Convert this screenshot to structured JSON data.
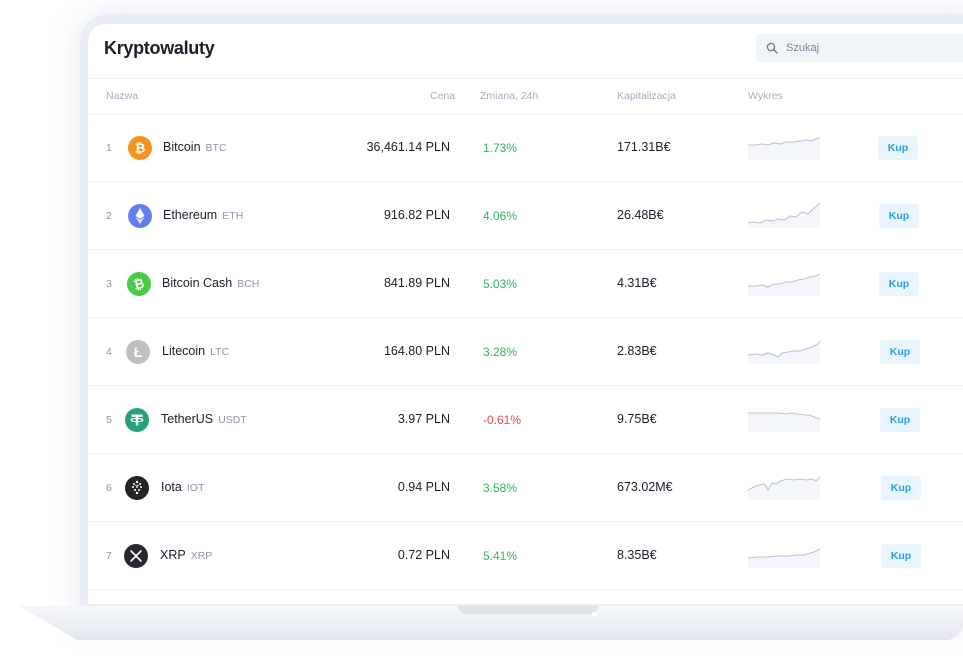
{
  "header": {
    "title": "Kryptowaluty"
  },
  "search": {
    "placeholder": "Szukaj"
  },
  "columns": {
    "name": "Nazwa",
    "price": "Cena",
    "change": "Zmiana, 24h",
    "cap": "Kapitalizacja",
    "chart": "Wykres"
  },
  "colors": {
    "positive": "#2fb65b",
    "negative": "#e3474b",
    "buy_bg": "#e8f5fd",
    "buy_text": "#2b9ee6",
    "spark_line": "#b9c3d6"
  },
  "rows": [
    {
      "rank": "1",
      "name": "Bitcoin",
      "symbol": "BTC",
      "price": "36,461.14 PLN",
      "change": "1.73%",
      "direction": "up",
      "cap": "171.31B€",
      "icon": "bitcoin-icon",
      "icon_color": "#f7931a",
      "buy": "Kup"
    },
    {
      "rank": "2",
      "name": "Ethereum",
      "symbol": "ETH",
      "price": "916.82 PLN",
      "change": "4.06%",
      "direction": "up",
      "cap": "26.48B€",
      "icon": "ethereum-icon",
      "icon_color": "#627eea",
      "buy": "Kup"
    },
    {
      "rank": "3",
      "name": "Bitcoin Cash",
      "symbol": "BCH",
      "price": "841.89 PLN",
      "change": "5.03%",
      "direction": "up",
      "cap": "4.31B€",
      "icon": "bitcoin-cash-icon",
      "icon_color": "#4cc947",
      "buy": "Kup"
    },
    {
      "rank": "4",
      "name": "Litecoin",
      "symbol": "LTC",
      "price": "164.80 PLN",
      "change": "3.28%",
      "direction": "up",
      "cap": "2.83B€",
      "icon": "litecoin-icon",
      "icon_color": "#bfbfbf",
      "buy": "Kup"
    },
    {
      "rank": "5",
      "name": "TetherUS",
      "symbol": "USDT",
      "price": "3.97 PLN",
      "change": "-0.61%",
      "direction": "down",
      "cap": "9.75B€",
      "icon": "tether-icon",
      "icon_color": "#26a17b",
      "buy": "Kup"
    },
    {
      "rank": "6",
      "name": "Iota",
      "symbol": "IOT",
      "price": "0.94 PLN",
      "change": "3.58%",
      "direction": "up",
      "cap": "673.02M€",
      "icon": "iota-icon",
      "icon_color": "#242424",
      "buy": "Kup"
    },
    {
      "rank": "7",
      "name": "XRP",
      "symbol": "XRP",
      "price": "0.72 PLN",
      "change": "5.41%",
      "direction": "up",
      "cap": "8.35B€",
      "icon": "xrp-icon",
      "icon_color": "#23292f",
      "buy": "Kup"
    }
  ]
}
